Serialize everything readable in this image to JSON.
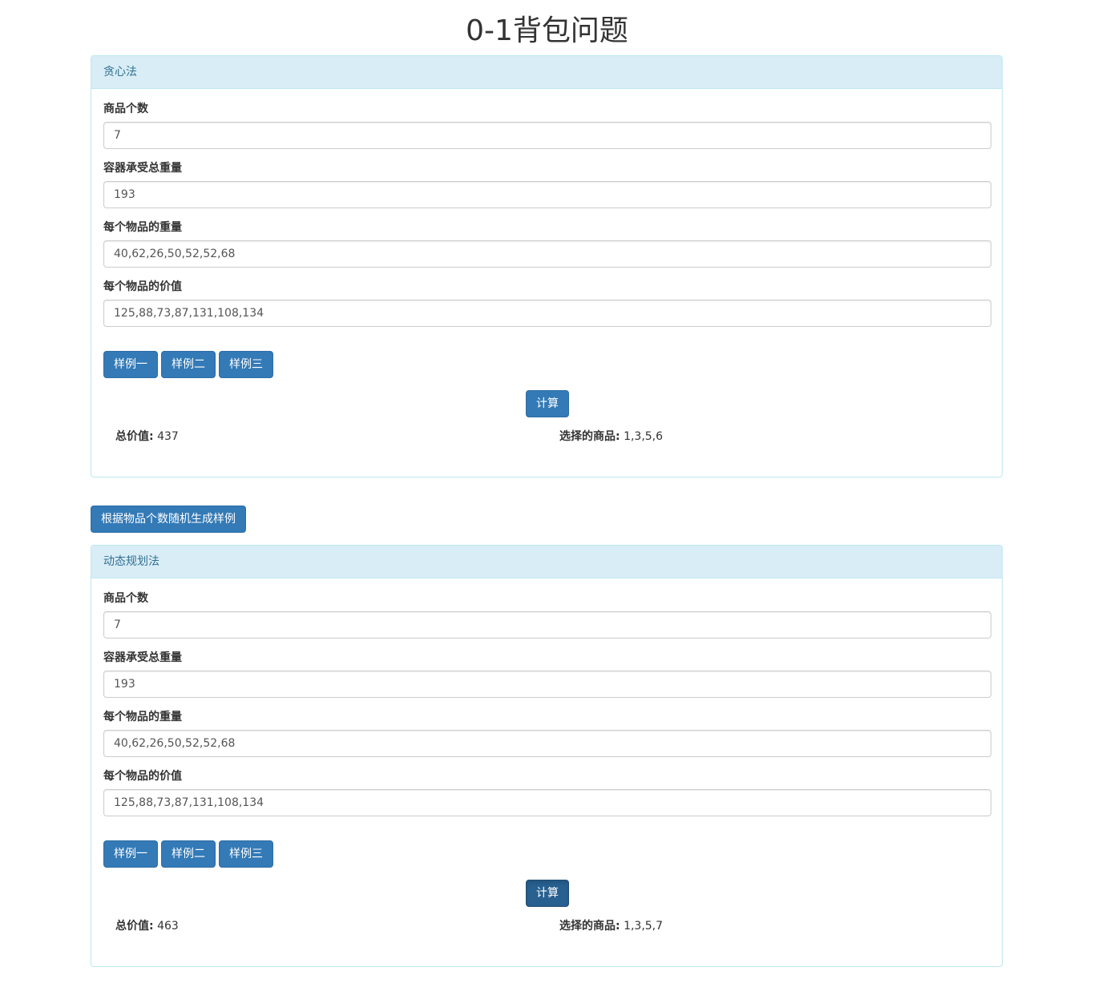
{
  "page": {
    "title": "0-1背包问题"
  },
  "random_button_label": "根据物品个数随机生成样例",
  "panels": [
    {
      "heading": "贪心法",
      "fields": [
        {
          "label": "商品个数",
          "value": "7"
        },
        {
          "label": "容器承受总重量",
          "value": "193"
        },
        {
          "label": "每个物品的重量",
          "value": "40,62,26,50,52,52,68"
        },
        {
          "label": "每个物品的价值",
          "value": "125,88,73,87,131,108,134"
        }
      ],
      "sample_buttons": [
        "样例一",
        "样例二",
        "样例三"
      ],
      "compute_label": "计算",
      "total_value_label": "总价值:",
      "total_value": "437",
      "selected_label": "选择的商品:",
      "selected": "1,3,5,6"
    },
    {
      "heading": "动态规划法",
      "fields": [
        {
          "label": "商品个数",
          "value": "7"
        },
        {
          "label": "容器承受总重量",
          "value": "193"
        },
        {
          "label": "每个物品的重量",
          "value": "40,62,26,50,52,52,68"
        },
        {
          "label": "每个物品的价值",
          "value": "125,88,73,87,131,108,134"
        }
      ],
      "sample_buttons": [
        "样例一",
        "样例二",
        "样例三"
      ],
      "compute_label": "计算",
      "total_value_label": "总价值:",
      "total_value": "463",
      "selected_label": "选择的商品:",
      "selected": "1,3,5,7"
    }
  ],
  "colors": {
    "primary": "#337ab7",
    "primary_active": "#286090",
    "panel_heading_bg": "#d9edf7",
    "panel_border": "#bce8f1",
    "panel_heading_text": "#31708f"
  }
}
